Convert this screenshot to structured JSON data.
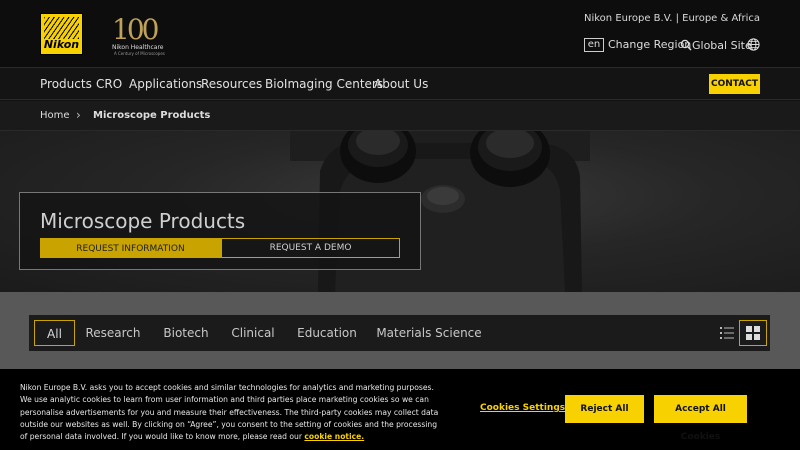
{
  "brand": {
    "logo_text": "Nikon",
    "anniversary_number": "100",
    "anniversary_title": "Nikon Healthcare",
    "anniversary_subtitle": "A Century of Microscopes"
  },
  "header": {
    "company": "Nikon Europe B.V. | Europe & Africa",
    "language": "en",
    "change_region": "Change Region",
    "global_site": "Global Site"
  },
  "nav": {
    "items": [
      {
        "label": "Products"
      },
      {
        "label": "CRO"
      },
      {
        "label": "Applications"
      },
      {
        "label": "Resources"
      },
      {
        "label": "BioImaging Centers"
      },
      {
        "label": "About Us"
      }
    ],
    "contact": "CONTACT"
  },
  "breadcrumb": {
    "home": "Home",
    "current": "Microscope Products"
  },
  "hero": {
    "title": "Microscope Products",
    "request_info": "REQUEST INFORMATION",
    "request_demo": "REQUEST A DEMO"
  },
  "filters": {
    "tabs": [
      {
        "label": "All"
      },
      {
        "label": "Research"
      },
      {
        "label": "Biotech"
      },
      {
        "label": "Clinical"
      },
      {
        "label": "Education"
      },
      {
        "label": "Materials Science"
      }
    ]
  },
  "cookie": {
    "text": "Nikon Europe B.V. asks you to accept cookies and similar technologies for analytics and marketing purposes. We use analytic cookies to learn from user information and third parties place marketing cookies so we can personalise advertisements for you and measure their effectiveness. The third-party cookies may collect data outside our websites as well. By clicking on “Agree”, you consent to the setting of cookies and the processing of personal data involved. If you would like to know more, please read our",
    "link": "cookie notice.",
    "settings": "Cookies Settings",
    "reject": "Reject All",
    "accept": "Accept All Cookies"
  },
  "colors": {
    "accent": "#f7d100",
    "background": "#121212"
  }
}
